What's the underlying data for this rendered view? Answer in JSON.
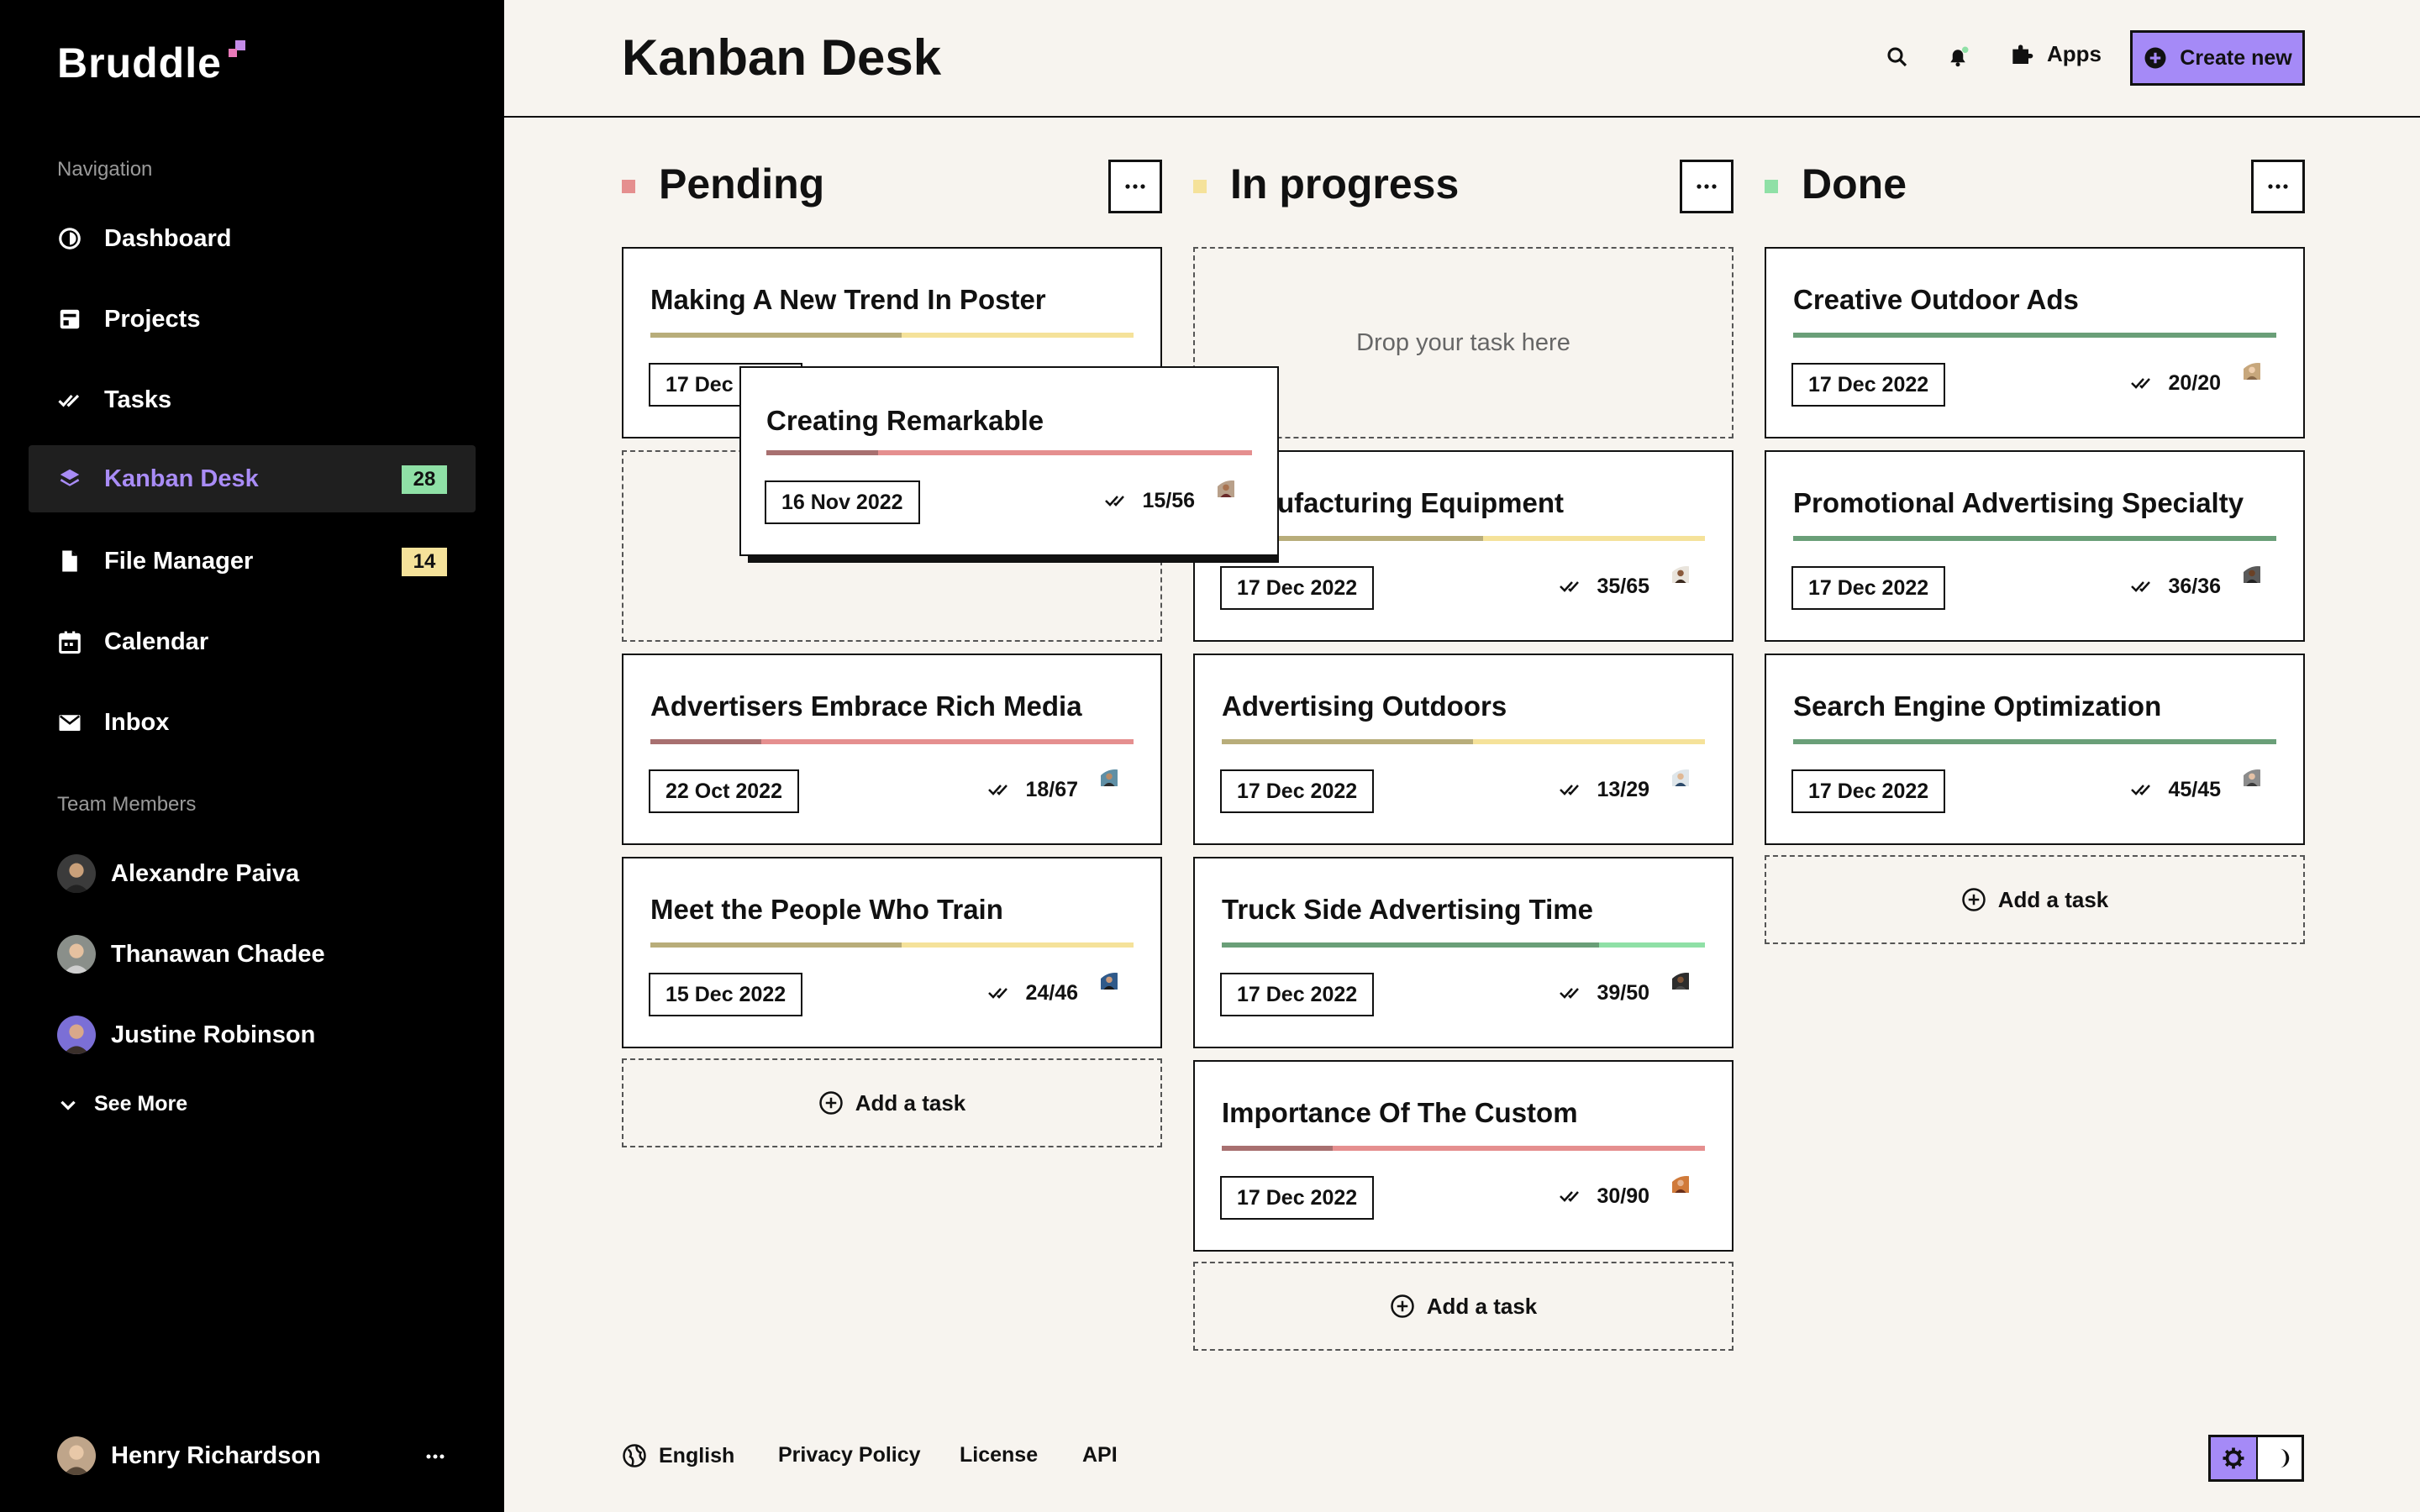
{
  "app": {
    "name": "Bruddle"
  },
  "colors": {
    "accent": "#a58af7",
    "pending": "#e58f8f",
    "in_progress": "#f5e29a",
    "done": "#8fe0a6",
    "badge_green": "#8fe0a6",
    "badge_yellow": "#f5e29a"
  },
  "sidebar": {
    "nav_heading": "Navigation",
    "nav": [
      {
        "label": "Dashboard",
        "icon": "dashboard-icon"
      },
      {
        "label": "Projects",
        "icon": "projects-icon"
      },
      {
        "label": "Tasks",
        "icon": "tasks-icon"
      },
      {
        "label": "Kanban Desk",
        "icon": "kanban-icon",
        "badge": "28",
        "active": true
      },
      {
        "label": "File Manager",
        "icon": "file-icon",
        "badge": "14"
      },
      {
        "label": "Calendar",
        "icon": "calendar-icon"
      },
      {
        "label": "Inbox",
        "icon": "inbox-icon"
      }
    ],
    "team_heading": "Team Members",
    "team": [
      {
        "name": "Alexandre Paiva"
      },
      {
        "name": "Thanawan Chadee"
      },
      {
        "name": "Justine Robinson"
      }
    ],
    "see_more": "See More",
    "user": {
      "name": "Henry Richardson"
    }
  },
  "header": {
    "title": "Kanban Desk",
    "apps_label": "Apps",
    "create_label": "Create new"
  },
  "columns": [
    {
      "title": "Pending",
      "cards": [
        {
          "title": "Making A New Trend In Poster",
          "date": "17 Dec 2022",
          "progress": 0.52
        },
        {
          "title": "Advertisers Embrace Rich Media",
          "date": "22 Oct 2022",
          "count": "18/67",
          "progress": 0.23
        },
        {
          "title": "Meet the People Who Train",
          "date": "15 Dec 2022",
          "count": "24/46",
          "progress": 0.52
        }
      ],
      "add_label": "Add a task"
    },
    {
      "title": "In progress",
      "drop_label": "Drop your task here",
      "cards": [
        {
          "title": "Manufacturing Equipment",
          "date": "17 Dec 2022",
          "count": "35/65",
          "progress": 0.54
        },
        {
          "title": "Advertising Outdoors",
          "date": "17 Dec 2022",
          "count": "13/29",
          "progress": 0.52
        },
        {
          "title": "Truck Side Advertising Time",
          "date": "17 Dec 2022",
          "count": "39/50",
          "progress": 0.78
        },
        {
          "title": "Importance Of The Custom",
          "date": "17 Dec 2022",
          "count": "30/90",
          "progress": 0.23
        }
      ],
      "add_label": "Add a task"
    },
    {
      "title": "Done",
      "cards": [
        {
          "title": "Creative Outdoor Ads",
          "date": "17 Dec 2022",
          "count": "20/20",
          "progress": 1
        },
        {
          "title": "Promotional Advertising Specialty",
          "date": "17 Dec 2022",
          "count": "36/36",
          "progress": 1
        },
        {
          "title": "Search Engine Optimization",
          "date": "17 Dec 2022",
          "count": "45/45",
          "progress": 1
        }
      ],
      "add_label": "Add a task"
    }
  ],
  "dragging": {
    "title": "Creating Remarkable",
    "date": "16 Nov 2022",
    "count": "15/56",
    "progress": 0.23
  },
  "footer": {
    "language": "English",
    "links": [
      "Privacy Policy",
      "License",
      "API"
    ]
  }
}
